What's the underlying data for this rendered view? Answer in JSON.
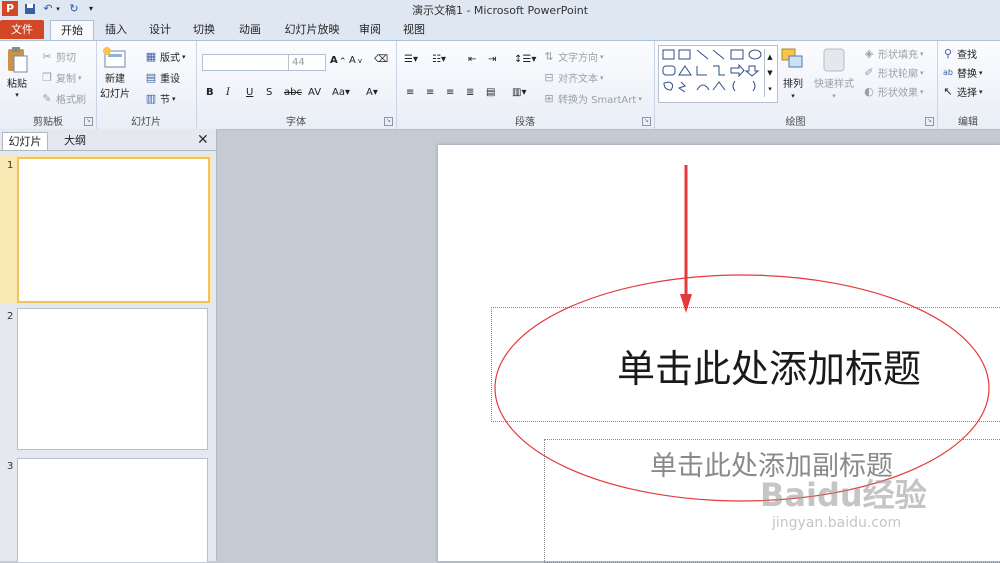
{
  "window": {
    "title": "演示文稿1 - Microsoft PowerPoint"
  },
  "qat": {
    "app_icon": "P",
    "save_icon": "save-icon",
    "undo_icon": "undo-icon",
    "redo_icon": "redo-icon",
    "customize_icon": "customize-icon"
  },
  "tabs": [
    {
      "label": "文件"
    },
    {
      "label": "开始"
    },
    {
      "label": "插入"
    },
    {
      "label": "设计"
    },
    {
      "label": "切换"
    },
    {
      "label": "动画"
    },
    {
      "label": "幻灯片放映"
    },
    {
      "label": "审阅"
    },
    {
      "label": "视图"
    }
  ],
  "ribbon": {
    "clipboard": {
      "label": "剪贴板",
      "paste": "粘贴",
      "cut": "剪切",
      "copy": "复制",
      "format_painter": "格式刷"
    },
    "slides": {
      "label": "幻灯片",
      "new_slide_line1": "新建",
      "new_slide_line2": "幻灯片",
      "layout": "版式",
      "reset": "重设",
      "section": "节"
    },
    "font": {
      "label": "字体",
      "font_name": "",
      "font_size": "44"
    },
    "paragraph": {
      "label": "段落",
      "text_direction": "文字方向",
      "align_text": "对齐文本",
      "convert_smartart": "转换为 SmartArt"
    },
    "drawing": {
      "label": "绘图",
      "arrange": "排列",
      "quick_styles": "快速样式",
      "shape_fill": "形状填充",
      "shape_outline": "形状轮廓",
      "shape_effects": "形状效果"
    },
    "editing": {
      "label": "编辑",
      "find": "查找",
      "replace": "替换",
      "select": "选择"
    }
  },
  "panel": {
    "tabs": [
      {
        "label": "幻灯片"
      },
      {
        "label": "大纲"
      }
    ],
    "slides": [
      {
        "number": "1"
      },
      {
        "number": "2"
      },
      {
        "number": "3"
      }
    ]
  },
  "slide": {
    "title_placeholder": "单击此处添加标题",
    "subtitle_placeholder": "单击此处添加副标题"
  },
  "watermark": {
    "brand": "Baidu经验",
    "url": "jingyan.baidu.com"
  },
  "colors": {
    "file_tab": "#d24726",
    "annotation_red": "#e43a3a",
    "selected_thumb": "#f0c45a"
  }
}
